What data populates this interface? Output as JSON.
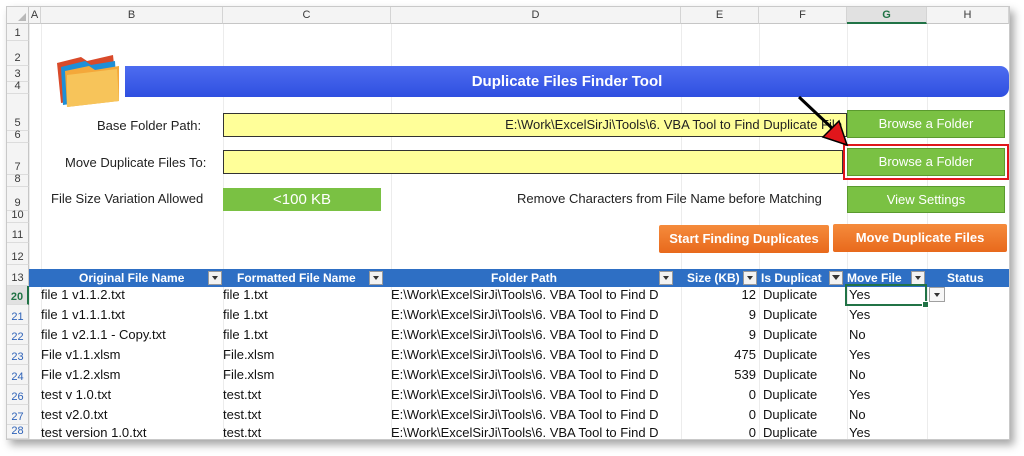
{
  "columns": [
    "A",
    "B",
    "C",
    "D",
    "E",
    "F",
    "G",
    "H"
  ],
  "rows": [
    "1",
    "2",
    "3",
    "4",
    "5",
    "6",
    "7",
    "8",
    "9",
    "10",
    "11",
    "12",
    "13",
    "20",
    "21",
    "22",
    "23",
    "24",
    "26",
    "27",
    "28"
  ],
  "tool": {
    "title": "Duplicate Files Finder Tool",
    "base_folder_label": "Base Folder Path:",
    "base_folder_value": "E:\\Work\\ExcelSirJi\\Tools\\6. VBA Tool to Find Duplicate File",
    "browse_label_1": "Browse a Folder",
    "move_to_label": "Move Duplicate Files To:",
    "move_to_value": "",
    "browse_label_2": "Browse a Folder",
    "size_variation_label": "File Size Variation Allowed",
    "size_variation_value": "<100 KB",
    "remove_chars_label": "Remove Characters from File Name before Matching",
    "view_settings_label": "View Settings",
    "start_label": "Start Finding Duplicates",
    "move_label": "Move Duplicate Files"
  },
  "table": {
    "headers": [
      "Original File Name",
      "Formatted File Name",
      "Folder Path",
      "Size (KB)",
      "Is Duplicat",
      "Move File",
      "Status"
    ],
    "rows": [
      [
        "file 1 v1.1.2.txt",
        "file 1.txt",
        "E:\\Work\\ExcelSirJi\\Tools\\6. VBA Tool to Find D",
        "12",
        "Duplicate",
        "Yes",
        ""
      ],
      [
        "file 1 v1.1.1.txt",
        "file 1.txt",
        "E:\\Work\\ExcelSirJi\\Tools\\6. VBA Tool to Find D",
        "9",
        "Duplicate",
        "Yes",
        ""
      ],
      [
        "file 1 v2.1.1 - Copy.txt",
        "file 1.txt",
        "E:\\Work\\ExcelSirJi\\Tools\\6. VBA Tool to Find D",
        "9",
        "Duplicate",
        "No",
        ""
      ],
      [
        "File v1.1.xlsm",
        "File.xlsm",
        "E:\\Work\\ExcelSirJi\\Tools\\6. VBA Tool to Find D",
        "475",
        "Duplicate",
        "Yes",
        ""
      ],
      [
        "File v1.2.xlsm",
        "File.xlsm",
        "E:\\Work\\ExcelSirJi\\Tools\\6. VBA Tool to Find D",
        "539",
        "Duplicate",
        "No",
        ""
      ],
      [
        "test v 1.0.txt",
        "test.txt",
        "E:\\Work\\ExcelSirJi\\Tools\\6. VBA Tool to Find D",
        "0",
        "Duplicate",
        "Yes",
        ""
      ],
      [
        "test v2.0.txt",
        "test.txt",
        "E:\\Work\\ExcelSirJi\\Tools\\6. VBA Tool to Find D",
        "0",
        "Duplicate",
        "No",
        ""
      ],
      [
        "test version 1.0.txt",
        "test.txt",
        "E:\\Work\\ExcelSirJi\\Tools\\6. VBA Tool to Find D",
        "0",
        "Duplicate",
        "Yes",
        ""
      ]
    ]
  },
  "colors": {
    "banner": "#3b5ce8",
    "green_button": "#7ac143",
    "orange_button": "#ef7a2a",
    "table_header": "#2e6fc4",
    "input_fill": "#ffff99",
    "highlight": "#e0161b"
  },
  "icons": {
    "logo": "folders-icon",
    "annotation": "arrow-pointer-icon"
  }
}
